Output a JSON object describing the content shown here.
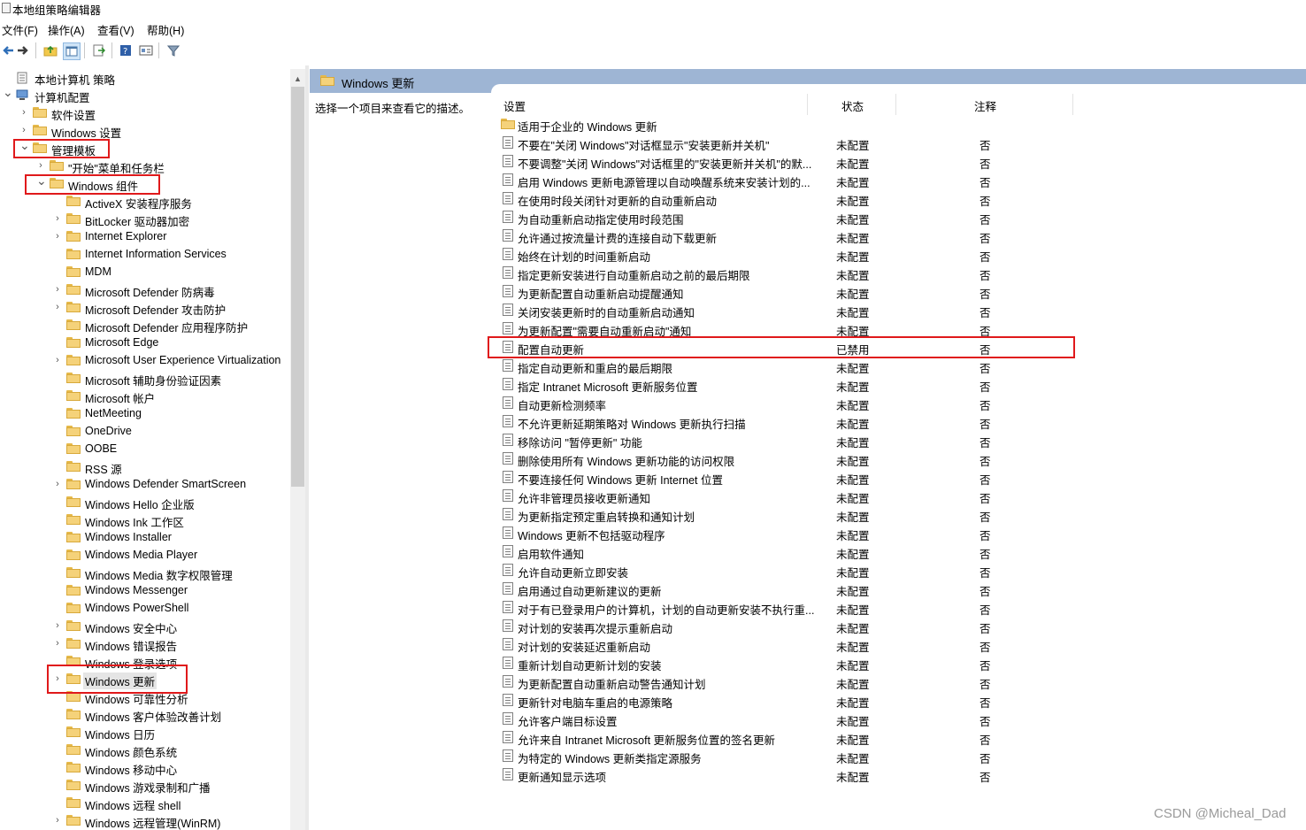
{
  "window": {
    "title": "本地组策略编辑器"
  },
  "menu": [
    "文件(F)",
    "操作(A)",
    "查看(V)",
    "帮助(H)"
  ],
  "toolbar_icons": [
    "back-arrow-icon",
    "forward-arrow-icon",
    "up-folder-icon",
    "show-hide-tree-icon",
    "export-list-icon",
    "help-icon",
    "properties-icon",
    "filter-icon"
  ],
  "tree": {
    "items": [
      {
        "label": "本地计算机 策略"
      },
      {
        "label": "计算机配置"
      },
      {
        "label": "软件设置"
      },
      {
        "label": "Windows 设置"
      },
      {
        "label": "管理模板"
      },
      {
        "label": "\"开始\"菜单和任务栏"
      },
      {
        "label": "Windows 组件"
      },
      {
        "label": "ActiveX 安装程序服务"
      },
      {
        "label": "BitLocker 驱动器加密"
      },
      {
        "label": "Internet Explorer"
      },
      {
        "label": "Internet Information Services"
      },
      {
        "label": "MDM"
      },
      {
        "label": "Microsoft Defender 防病毒"
      },
      {
        "label": "Microsoft Defender 攻击防护"
      },
      {
        "label": "Microsoft Defender 应用程序防护"
      },
      {
        "label": "Microsoft Edge"
      },
      {
        "label": "Microsoft User Experience Virtualization"
      },
      {
        "label": "Microsoft 辅助身份验证因素"
      },
      {
        "label": "Microsoft 帐户"
      },
      {
        "label": "NetMeeting"
      },
      {
        "label": "OneDrive"
      },
      {
        "label": "OOBE"
      },
      {
        "label": "RSS 源"
      },
      {
        "label": "Windows Defender SmartScreen"
      },
      {
        "label": "Windows Hello 企业版"
      },
      {
        "label": "Windows Ink 工作区"
      },
      {
        "label": "Windows Installer"
      },
      {
        "label": "Windows Media Player"
      },
      {
        "label": "Windows Media 数字权限管理"
      },
      {
        "label": "Windows Messenger"
      },
      {
        "label": "Windows PowerShell"
      },
      {
        "label": "Windows 安全中心"
      },
      {
        "label": "Windows 错误报告"
      },
      {
        "label": "Windows 登录选项"
      },
      {
        "label": "Windows 更新"
      },
      {
        "label": "Windows 可靠性分析"
      },
      {
        "label": "Windows 客户体验改善计划"
      },
      {
        "label": "Windows 日历"
      },
      {
        "label": "Windows 颜色系统"
      },
      {
        "label": "Windows 移动中心"
      },
      {
        "label": "Windows 游戏录制和广播"
      },
      {
        "label": "Windows 远程 shell"
      },
      {
        "label": "Windows 远程管理(WinRM)"
      }
    ]
  },
  "right": {
    "header_title": "Windows 更新",
    "description": "选择一个项目来查看它的描述。",
    "columns": {
      "setting": "设置",
      "state": "状态",
      "note": "注释"
    },
    "folder_row": "适用于企业的 Windows 更新",
    "policies": [
      {
        "name": "不要在\"关闭 Windows\"对话框显示\"安装更新并关机\"",
        "state": "未配置",
        "note": "否"
      },
      {
        "name": "不要调整\"关闭 Windows\"对话框里的\"安装更新并关机\"的默...",
        "state": "未配置",
        "note": "否"
      },
      {
        "name": "启用 Windows 更新电源管理以自动唤醒系统来安装计划的...",
        "state": "未配置",
        "note": "否"
      },
      {
        "name": "在使用时段关闭针对更新的自动重新启动",
        "state": "未配置",
        "note": "否"
      },
      {
        "name": "为自动重新启动指定使用时段范围",
        "state": "未配置",
        "note": "否"
      },
      {
        "name": "允许通过按流量计费的连接自动下载更新",
        "state": "未配置",
        "note": "否"
      },
      {
        "name": "始终在计划的时间重新启动",
        "state": "未配置",
        "note": "否"
      },
      {
        "name": "指定更新安装进行自动重新启动之前的最后期限",
        "state": "未配置",
        "note": "否"
      },
      {
        "name": "为更新配置自动重新启动提醒通知",
        "state": "未配置",
        "note": "否"
      },
      {
        "name": "关闭安装更新时的自动重新启动通知",
        "state": "未配置",
        "note": "否"
      },
      {
        "name": "为更新配置\"需要自动重新启动\"通知",
        "state": "未配置",
        "note": "否"
      },
      {
        "name": "配置自动更新",
        "state": "已禁用",
        "note": "否"
      },
      {
        "name": "指定自动更新和重启的最后期限",
        "state": "未配置",
        "note": "否"
      },
      {
        "name": "指定 Intranet Microsoft 更新服务位置",
        "state": "未配置",
        "note": "否"
      },
      {
        "name": "自动更新检测频率",
        "state": "未配置",
        "note": "否"
      },
      {
        "name": "不允许更新延期策略对 Windows 更新执行扫描",
        "state": "未配置",
        "note": "否"
      },
      {
        "name": "移除访问 \"暂停更新\" 功能",
        "state": "未配置",
        "note": "否"
      },
      {
        "name": "删除使用所有 Windows 更新功能的访问权限",
        "state": "未配置",
        "note": "否"
      },
      {
        "name": "不要连接任何 Windows 更新 Internet 位置",
        "state": "未配置",
        "note": "否"
      },
      {
        "name": "允许非管理员接收更新通知",
        "state": "未配置",
        "note": "否"
      },
      {
        "name": "为更新指定预定重启转换和通知计划",
        "state": "未配置",
        "note": "否"
      },
      {
        "name": "Windows 更新不包括驱动程序",
        "state": "未配置",
        "note": "否"
      },
      {
        "name": "启用软件通知",
        "state": "未配置",
        "note": "否"
      },
      {
        "name": "允许自动更新立即安装",
        "state": "未配置",
        "note": "否"
      },
      {
        "name": "启用通过自动更新建议的更新",
        "state": "未配置",
        "note": "否"
      },
      {
        "name": "对于有已登录用户的计算机，计划的自动更新安装不执行重...",
        "state": "未配置",
        "note": "否"
      },
      {
        "name": "对计划的安装再次提示重新启动",
        "state": "未配置",
        "note": "否"
      },
      {
        "name": "对计划的安装延迟重新启动",
        "state": "未配置",
        "note": "否"
      },
      {
        "name": "重新计划自动更新计划的安装",
        "state": "未配置",
        "note": "否"
      },
      {
        "name": "为更新配置自动重新启动警告通知计划",
        "state": "未配置",
        "note": "否"
      },
      {
        "name": "更新针对电脑车重启的电源策略",
        "state": "未配置",
        "note": "否"
      },
      {
        "name": "允许客户端目标设置",
        "state": "未配置",
        "note": "否"
      },
      {
        "name": "允许来自 Intranet Microsoft 更新服务位置的签名更新",
        "state": "未配置",
        "note": "否"
      },
      {
        "name": "为特定的 Windows 更新类指定源服务",
        "state": "未配置",
        "note": "否"
      },
      {
        "name": "更新通知显示选项",
        "state": "未配置",
        "note": "否"
      }
    ]
  },
  "watermark": "CSDN @Micheal_Dad",
  "colors": {
    "highlight_box": "#e0191b",
    "header_band": "#9eb5d4"
  }
}
